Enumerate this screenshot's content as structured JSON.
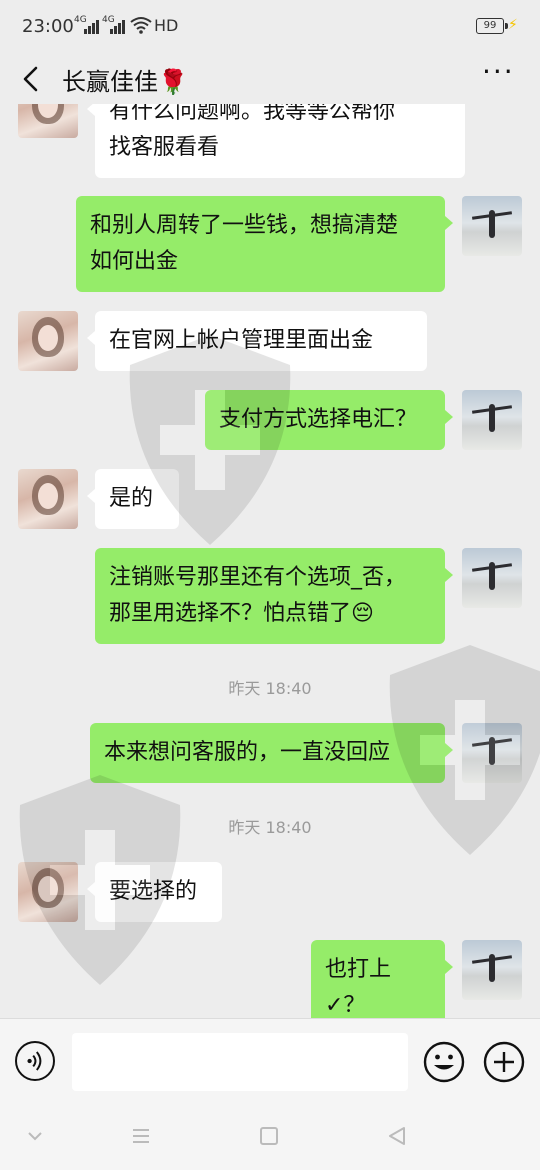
{
  "status_bar": {
    "time": "23:00",
    "net1": "4G",
    "net2": "4G",
    "hd": "HD",
    "battery": "99"
  },
  "header": {
    "title": "长赢佳佳🌹",
    "more": "···"
  },
  "messages": [
    {
      "side": "left",
      "text": "有什么问题啊。我等等公帮你\n找客服看看"
    },
    {
      "side": "right",
      "text": "和别人周转了一些钱，想搞清楚\n如何出金"
    },
    {
      "side": "left",
      "text": "在官网上帐户管理里面出金"
    },
    {
      "side": "right",
      "text": "支付方式选择电汇？"
    },
    {
      "side": "left",
      "text": "是的"
    },
    {
      "side": "right",
      "text": "注销账号那里还有个选项_否，\n那里用选择不？怕点错了😔"
    },
    {
      "side": "time",
      "text": "昨天 18:40"
    },
    {
      "side": "right",
      "text": "本来想问客服的，一直没回应"
    },
    {
      "side": "time",
      "text": "昨天 18:40"
    },
    {
      "side": "left",
      "text": "要选择的"
    },
    {
      "side": "right",
      "text": "也打上✓？"
    }
  ],
  "input": {
    "value": "",
    "placeholder": ""
  },
  "icons": {
    "back": "chevron-left-icon",
    "more": "more-dots-icon",
    "voice": "voice-icon",
    "emoji": "emoji-icon",
    "plus": "plus-icon",
    "nav_down": "chevron-down-icon",
    "nav_menu": "menu-icon",
    "nav_home": "square-home-icon",
    "nav_back": "triangle-back-icon"
  },
  "colors": {
    "background": "#ededed",
    "bubble_self": "#95ec69",
    "bubble_other": "#ffffff"
  }
}
